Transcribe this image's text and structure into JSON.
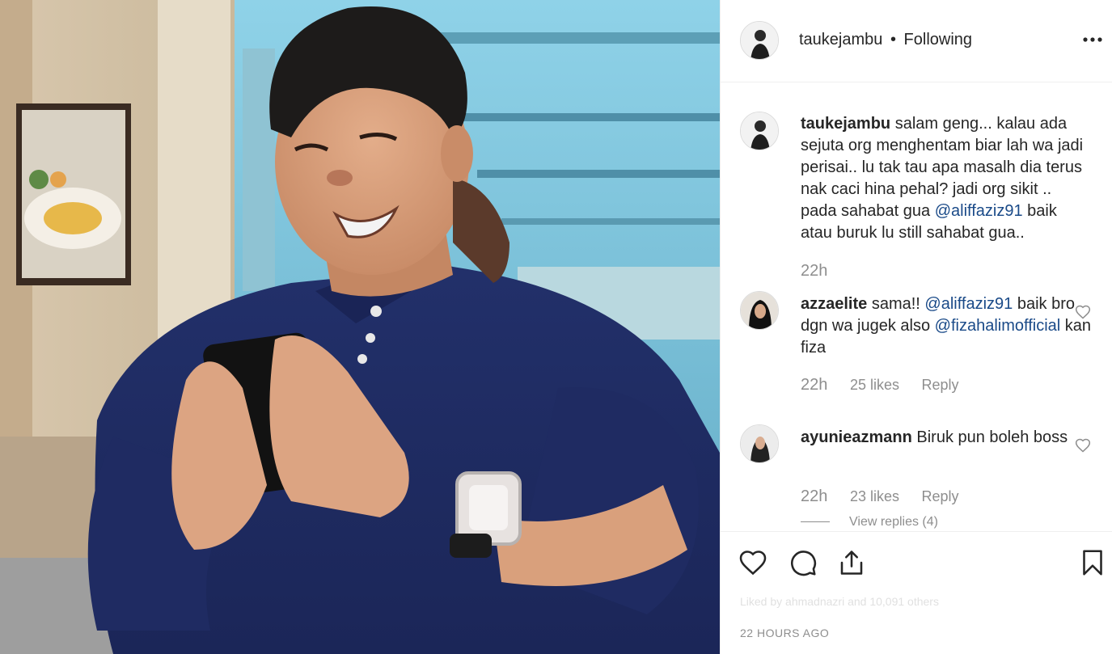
{
  "post": {
    "username": "taukejambu",
    "separator": "•",
    "follow_status": "Following"
  },
  "icons": {
    "more": "more-options-icon",
    "like": "heart-icon",
    "comment": "comment-bubble-icon",
    "share": "share-icon",
    "save": "bookmark-icon"
  },
  "caption": {
    "username": "taukejambu",
    "text_before": " salam geng... kalau ada sejuta org menghentam biar lah wa jadi perisai.. lu tak tau apa masalh dia terus nak caci hina pehal? jadi org sikit .. pada sahabat gua ",
    "mention": "@aliffaziz91",
    "text_after": " baik atau buruk lu still sahabat gua..",
    "time": "22h"
  },
  "comments": [
    {
      "username": "azzaelite",
      "text_before": " sama!! ",
      "mention1": "@aliffaziz91",
      "text_middle": " baik bro dgn wa jugek also ",
      "mention2": "@fizahalimofficial",
      "text_after": " kan fiza",
      "time": "22h",
      "likes": "25 likes",
      "reply": "Reply"
    },
    {
      "username": "ayunieazmann",
      "text": " Biruk pun boleh boss",
      "time": "22h",
      "likes": "23 likes",
      "reply": "Reply"
    }
  ],
  "view_replies": "View replies (4)",
  "liked_by_faded": "Liked by ahmadnazri and 10,091 others",
  "timestamp": "22 HOURS AGO"
}
